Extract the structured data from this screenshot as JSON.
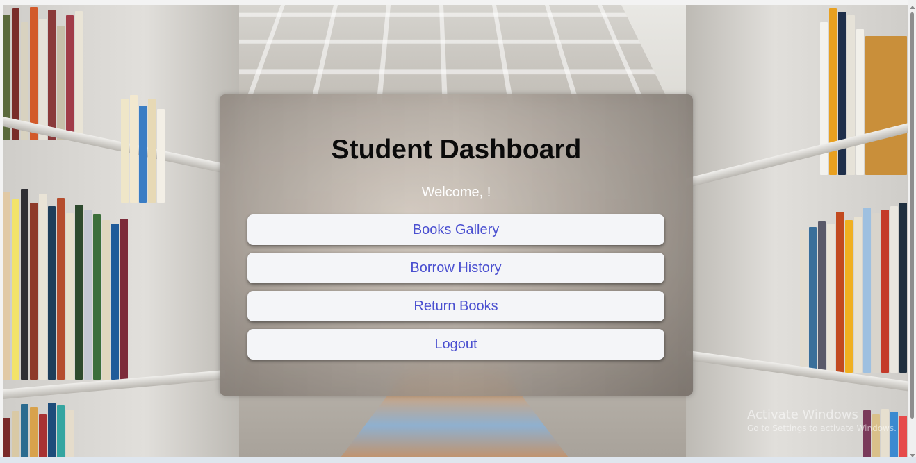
{
  "dashboard": {
    "title": "Student Dashboard",
    "welcome": "Welcome, !",
    "menu": [
      {
        "label": "Books Gallery"
      },
      {
        "label": "Borrow History"
      },
      {
        "label": "Return Books"
      },
      {
        "label": "Logout"
      }
    ]
  },
  "watermark": {
    "title": "Activate Windows",
    "subtitle": "Go to Settings to activate Windows."
  },
  "colors": {
    "button_text": "#4a4fd0",
    "button_bg": "#f4f5f8",
    "title": "#0b0b0b",
    "welcome": "#ffffff"
  },
  "background": {
    "icon": "library-bookshelf-image"
  }
}
